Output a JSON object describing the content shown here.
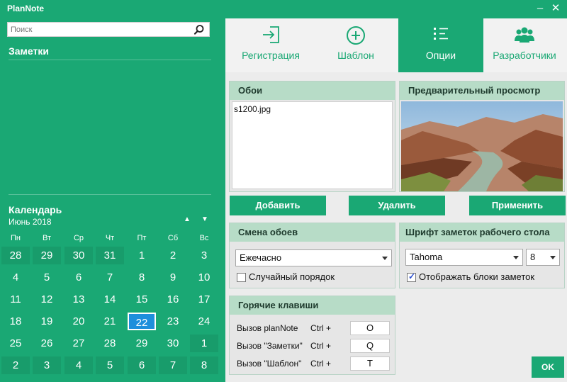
{
  "app": {
    "title": "PlanNote"
  },
  "search": {
    "placeholder": "Поиск"
  },
  "notes": {
    "title": "Заметки"
  },
  "calendar": {
    "title": "Календарь",
    "month": "Июнь 2018",
    "weekdays": [
      "Пн",
      "Вт",
      "Ср",
      "Чт",
      "Пт",
      "Сб",
      "Вс"
    ],
    "weeks": [
      [
        "28",
        "29",
        "30",
        "31",
        "1",
        "2",
        "3"
      ],
      [
        "4",
        "5",
        "6",
        "7",
        "8",
        "9",
        "10"
      ],
      [
        "11",
        "12",
        "13",
        "14",
        "15",
        "16",
        "17"
      ],
      [
        "18",
        "19",
        "20",
        "21",
        "22",
        "23",
        "24"
      ],
      [
        "25",
        "26",
        "27",
        "28",
        "29",
        "30",
        "1"
      ],
      [
        "2",
        "3",
        "4",
        "5",
        "6",
        "7",
        "8"
      ]
    ],
    "selected": "22"
  },
  "tabs": [
    {
      "label": "Регистрация",
      "icon": "login-icon"
    },
    {
      "label": "Шаблон",
      "icon": "plus-circle-icon"
    },
    {
      "label": "Опции",
      "icon": "list-icon",
      "active": true
    },
    {
      "label": "Разработчики",
      "icon": "users-icon"
    }
  ],
  "wallpaper": {
    "title": "Обои",
    "files": [
      "s1200.jpg"
    ],
    "add_label": "Добавить",
    "delete_label": "Удалить",
    "apply_label": "Применить"
  },
  "preview": {
    "title": "Предварительный просмотр"
  },
  "wallpaper_change": {
    "title": "Смена обоев",
    "interval": "Ежечасно",
    "random_label": "Случайный порядок",
    "random_checked": false
  },
  "font": {
    "title": "Шрифт заметок рабочего стола",
    "family": "Tahoma",
    "size": "8",
    "show_blocks_label": "Отображать блоки заметок",
    "show_blocks_checked": true
  },
  "hotkeys": {
    "title": "Горячие клавиши",
    "rows": [
      {
        "label": "Вызов planNote",
        "mod": "Ctrl +",
        "key": "O"
      },
      {
        "label": "Вызов \"Заметки\"",
        "mod": "Ctrl +",
        "key": "Q"
      },
      {
        "label": "Вызов \"Шаблон\"",
        "mod": "Ctrl +",
        "key": "T"
      }
    ]
  },
  "ok_label": "OK",
  "colors": {
    "accent": "#1aa874",
    "panel_header": "#b7dcc7",
    "selected_day": "#1e8fdc"
  }
}
